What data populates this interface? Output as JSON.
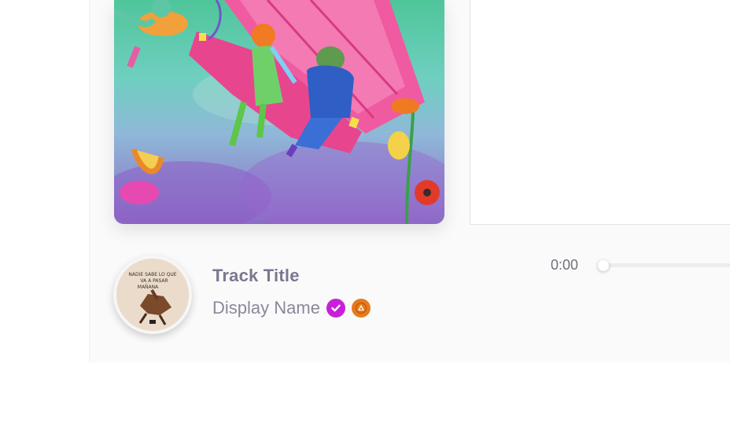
{
  "player": {
    "track_title": "Track Title",
    "display_name": "Display Name",
    "elapsed": "0:00",
    "progress": 0
  },
  "badges": {
    "verified_icon": "verified-check-icon",
    "tier_icon": "tier-triangle-icon",
    "verified_color": "#c621d8",
    "tier_color": "#e67a1c"
  },
  "thumbnail": {
    "lines": [
      "NADIE SABE LO QUE",
      "VA A PASAR",
      "MAÑANA"
    ]
  }
}
